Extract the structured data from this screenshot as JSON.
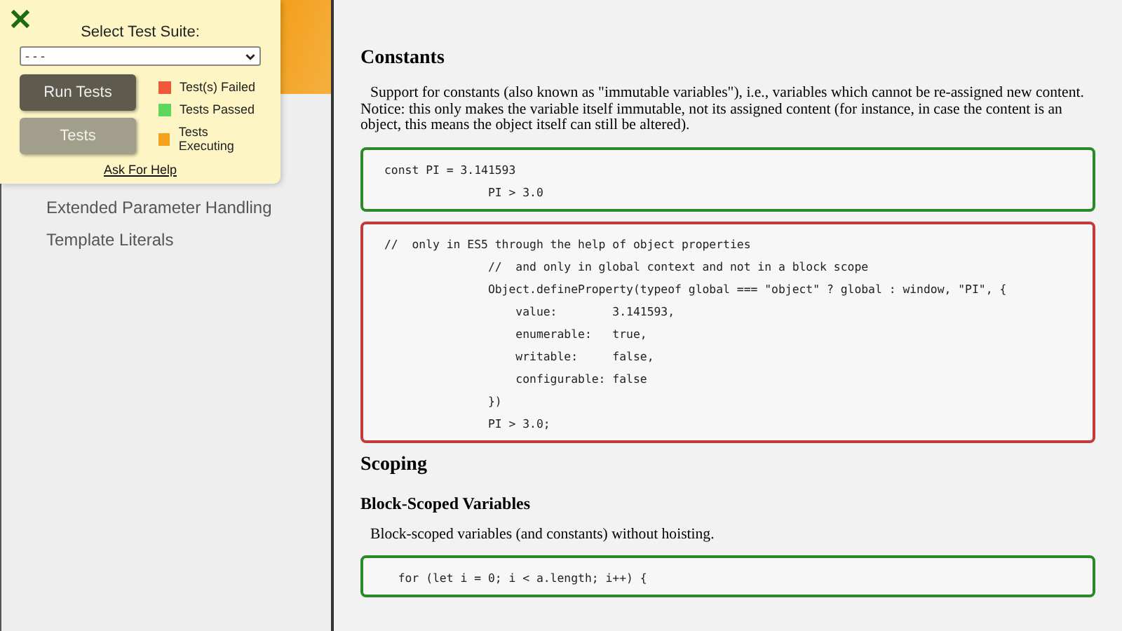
{
  "test_panel": {
    "select_label": "Select Test Suite:",
    "select_value": "- - -",
    "buttons": [
      {
        "label": "Run Tests",
        "disabled": false
      },
      {
        "label": "Tests",
        "disabled": true
      }
    ],
    "legend": [
      {
        "label": "Test(s) Failed",
        "color": "#f0563a"
      },
      {
        "label": "Tests Passed",
        "color": "#5cd65c"
      },
      {
        "label": "Tests Executing",
        "color": "#f5a01e"
      }
    ],
    "help_link": "Ask For Help"
  },
  "sidebar": {
    "items": [
      {
        "label": "Extended Parameter Handling"
      },
      {
        "label": "Template Literals"
      }
    ]
  },
  "content": [
    {
      "kind": "heading",
      "text": "Constants"
    },
    {
      "kind": "paragraph",
      "text": "Support for constants (also known as \"immutable variables\"), i.e., variables which cannot be re-assigned new content. Notice: this only makes the variable itself immutable, not its assigned content (for instance, in case the content is an object, this means the object itself can still be altered)."
    },
    {
      "kind": "code",
      "passed": true,
      "lines": [
        "const PI = 3.141593",
        "               PI > 3.0"
      ]
    },
    {
      "kind": "code",
      "passed": false,
      "lines": [
        "//  only in ES5 through the help of object properties",
        "               //  and only in global context and not in a block scope",
        "               Object.defineProperty(typeof global === \"object\" ? global : window, \"PI\", {",
        "                   value:        3.141593,",
        "                   enumerable:   true,",
        "                   writable:     false,",
        "                   configurable: false",
        "               })",
        "               PI > 3.0;"
      ]
    },
    {
      "kind": "heading",
      "text": "Scoping"
    },
    {
      "kind": "subheading",
      "text": "Block-Scoped Variables"
    },
    {
      "kind": "paragraph",
      "text": "Block-scoped variables (and constants) without hoisting."
    },
    {
      "kind": "code",
      "passed": true,
      "lines": [
        "  for (let i = 0; i < a.length; i++) {"
      ]
    }
  ]
}
